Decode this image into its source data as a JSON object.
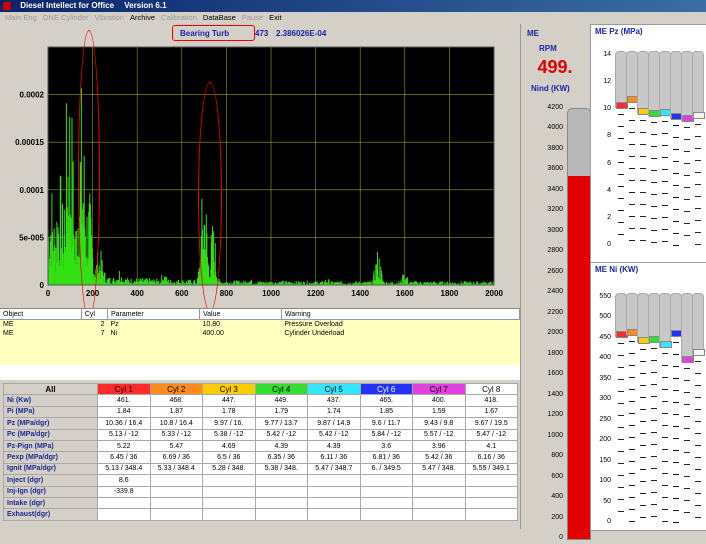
{
  "window": {
    "app_name": "Diesel Intellect for Office",
    "version": "Version 6.1"
  },
  "menu": [
    {
      "label": "Main Eng",
      "enabled": false
    },
    {
      "label": "ONE Cylinder",
      "enabled": false
    },
    {
      "label": "Vibration",
      "enabled": false
    },
    {
      "label": "Archive",
      "enabled": true
    },
    {
      "label": "Calibration",
      "enabled": false
    },
    {
      "label": "DataBase",
      "enabled": true
    },
    {
      "label": "Pause",
      "enabled": false
    },
    {
      "label": "Exit",
      "enabled": true
    }
  ],
  "header": {
    "signal_name": "Bearing Turb",
    "signal_id": "473",
    "signal_value": "2.386026E-04"
  },
  "chart_data": {
    "type": "line",
    "title": "",
    "xlabel": "",
    "ylabel": "",
    "xlim": [
      0,
      2000
    ],
    "ylim": [
      0,
      0.00025
    ],
    "x_ticks": [
      "0",
      "200",
      "400",
      "600",
      "800",
      "1000",
      "1200",
      "1400",
      "1600",
      "1800",
      "2000"
    ],
    "y_ticks": [
      "0",
      "5e-005",
      "0.0001",
      "0.00015",
      "0.0002"
    ],
    "grid": true,
    "background": "#000000",
    "grid_color": "#9a9a20",
    "series": [
      {
        "color": "#33e014",
        "peaks": [
          [
            12,
            0.00012
          ],
          [
            50,
            0.00013
          ],
          [
            95,
            0.00025
          ],
          [
            150,
            0.00022
          ],
          [
            180,
            0.00011
          ],
          [
            230,
            4e-05
          ],
          [
            320,
            2e-05
          ],
          [
            520,
            1.5e-05
          ],
          [
            700,
            0.00013
          ],
          [
            740,
            7e-05
          ],
          [
            900,
            1e-05
          ],
          [
            1250,
            8e-06
          ],
          [
            1480,
            4e-05
          ],
          [
            1600,
            1.5e-05
          ],
          [
            1800,
            5e-06
          ]
        ]
      }
    ]
  },
  "warnings": {
    "columns": [
      "Object",
      "Cyl",
      "Parameter",
      "Value",
      "Warning"
    ],
    "rows": [
      [
        "ME",
        "2",
        "Pz",
        "10.80",
        "Pressure Overload"
      ],
      [
        "ME",
        "7",
        "Ni",
        "400.00",
        "Cylinder Underload"
      ]
    ]
  },
  "cylinders": {
    "all_label": "All",
    "headers": [
      "Cyl 1",
      "Cyl 2",
      "Cyl 3",
      "Cyl 4",
      "Cyl 5",
      "Cyl 6",
      "Cyl 7",
      "Cyl 8"
    ],
    "header_colors": [
      "#ff2a2a",
      "#ff8c1a",
      "#ffcc00",
      "#33dd33",
      "#33e5ff",
      "#2233ff",
      "#e040e0",
      "#ffffff"
    ],
    "header_text_colors": [
      "#000",
      "#000",
      "#000",
      "#000",
      "#000",
      "#ffffff",
      "#000",
      "#000"
    ],
    "rows": [
      {
        "label": "Ni    (Kw)",
        "values": [
          "461.",
          "468.",
          "447.",
          "449.",
          "437.",
          "465.",
          "400.",
          "418."
        ]
      },
      {
        "label": "Pi     (MPa)",
        "values": [
          "1.84",
          "1.87",
          "1.78",
          "1.79",
          "1.74",
          "1.85",
          "1.59",
          "1.67"
        ]
      },
      {
        "label": "Pz     (MPa/dgr)",
        "values": [
          "10.36 / 16.4",
          "10.8 / 16.4",
          "9.97 / 16.",
          "9.77 / 13.7",
          "9.87 / 14.9",
          "9.6 / 11.7",
          "9.43 / 9.8",
          "9.67 / 19.5"
        ]
      },
      {
        "label": "Pc     (MPa/dgr)",
        "values": [
          "5.13 / -12",
          "5.33 / -12",
          "5.38 / -12",
          "5.42 / -12",
          "5.42 / -12",
          "5.84 / -12",
          "5.57 / -12",
          "5.47 / -12"
        ]
      },
      {
        "label": "Pz-Pign   (MPa)",
        "values": [
          "5.22",
          "5.47",
          "4.69",
          "4.39",
          "4.39",
          "3.6",
          "3.96",
          "4.1"
        ]
      },
      {
        "label": "Pexp  (MPa/dgr)",
        "values": [
          "6.45 / 36",
          "6.69 / 36",
          "6.5 / 36",
          "6.35 / 36",
          "6.11 / 36",
          "6.81 / 36",
          "5.42 / 36",
          "6.16 / 36"
        ]
      },
      {
        "label": "Ignit  (MPa/dgr)",
        "values": [
          "5.13 / 348.4",
          "5.33 / 348.4",
          "5.28 / 348.",
          "5.38 / 348.",
          "5.47 / 348.7",
          "6. / 349.5",
          "5.47 / 348.",
          "5.55 / 349.1"
        ]
      },
      {
        "label": "Inject (dgr)",
        "values": [
          "8.6",
          "",
          "",
          "",
          "",
          "",
          "",
          ""
        ]
      },
      {
        "label": "Inj-Ign  (dgr)",
        "values": [
          "-339.8",
          "",
          "",
          "",
          "",
          "",
          "",
          ""
        ]
      },
      {
        "label": "Intake (dgr)",
        "values": [
          "",
          "",
          "",
          "",
          "",
          "",
          "",
          ""
        ]
      },
      {
        "label": "Exhaust(dgr)",
        "values": [
          "",
          "",
          "",
          "",
          "",
          "",
          "",
          ""
        ]
      }
    ]
  },
  "me_panel": {
    "title": "ME",
    "rpm_label": "RPM",
    "rpm_value": "499.",
    "nind_label": "Nind (KW)",
    "scale": [
      "4200",
      "4000",
      "3800",
      "3600",
      "3400",
      "3200",
      "3000",
      "2800",
      "2600",
      "2400",
      "2200",
      "2000",
      "1800",
      "1600",
      "1400",
      "1200",
      "1000",
      "800",
      "600",
      "400",
      "200",
      "0"
    ],
    "nind_value": 3550
  },
  "pz_panel": {
    "title": "ME Pz  (MPa)",
    "scale": [
      "14",
      "12",
      "10",
      "8",
      "6",
      "4",
      "2",
      "0"
    ],
    "values": [
      10.36,
      10.8,
      9.97,
      9.77,
      9.87,
      9.6,
      9.43,
      9.67
    ]
  },
  "ni_panel": {
    "title": "ME Ni  (KW)",
    "scale": [
      "550",
      "500",
      "450",
      "400",
      "350",
      "300",
      "250",
      "200",
      "150",
      "100",
      "50",
      "0"
    ],
    "values": [
      461,
      468,
      447,
      449,
      437,
      465,
      400,
      418
    ]
  }
}
